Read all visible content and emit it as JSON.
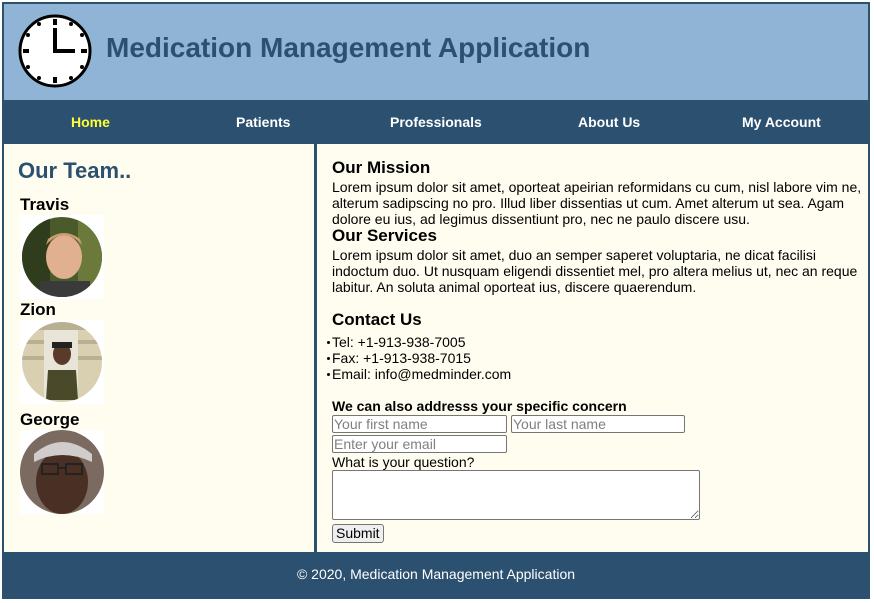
{
  "header": {
    "title": "Medication Management Application",
    "logo_icon": "clock-icon"
  },
  "nav": {
    "items": [
      {
        "label": "Home",
        "active": true
      },
      {
        "label": "Patients",
        "active": false
      },
      {
        "label": "Professionals",
        "active": false
      },
      {
        "label": "About Us",
        "active": false
      },
      {
        "label": "My Account",
        "active": false
      }
    ]
  },
  "team": {
    "title": "Our Team..",
    "members": [
      {
        "name": "Travis"
      },
      {
        "name": "Zion"
      },
      {
        "name": "George"
      }
    ]
  },
  "mission": {
    "title": "Our Mission",
    "text": "Lorem ipsum dolor sit amet, oporteat apeirian reformidans cu cum, nisl labore vim ne, alterum sadipscing no pro. Illud liber dissentias ut cum. Amet alterum ut sea. Agam dolore eu ius, ad legimus dissentiunt pro, nec ne paulo discere usu."
  },
  "services": {
    "title": "Our Services",
    "text": "Lorem ipsum dolor sit amet, duo an semper saperet voluptaria, ne dicat facilisi indoctum duo. Ut nusquam eligendi dissentiet mel, pro altera melius ut, nec an reque labitur. An soluta animal oporteat ius, discere quaerendum."
  },
  "contact": {
    "title": "Contact Us",
    "items": [
      "Tel: +1-913-938-7005",
      "Fax: +1-913-938-7015",
      "Email: info@medminder.com"
    ]
  },
  "form": {
    "title": "We can also addresss your specific concern",
    "first_name_placeholder": "Your first name",
    "last_name_placeholder": "Your last name",
    "email_placeholder": "Enter your email",
    "question_label": "What is your question?",
    "submit_label": "Submit"
  },
  "footer": {
    "text": "© 2020, Medication Management Application"
  },
  "colors": {
    "header_bg": "#8fb4d5",
    "nav_bg": "#2b5070",
    "active_nav": "#ffff33",
    "content_bg": "#fffdf0",
    "title": "#2b5070"
  }
}
